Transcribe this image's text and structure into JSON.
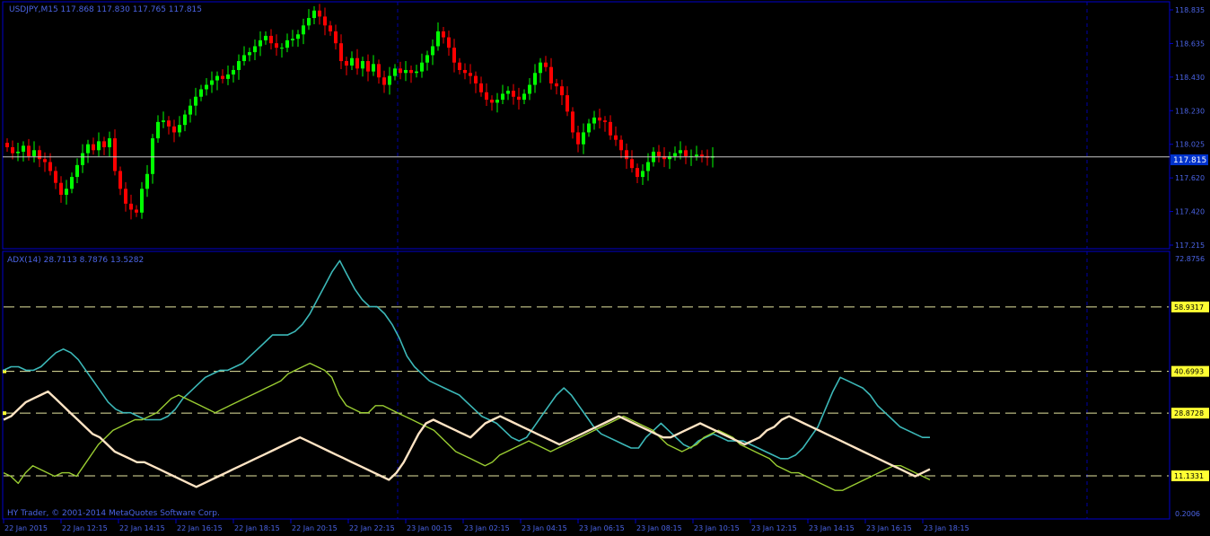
{
  "chart_header": "USDJPY,M15  117.868 117.830 117.765 117.815",
  "indicator_header": "ADX(14) 28.7113 8.7876 13.5282",
  "copyright": "HY Trader, © 2001-2014 MetaQuotes Software Corp.",
  "current_price_label": "117.815",
  "price_axis_labels": [
    "118.835",
    "118.635",
    "118.430",
    "118.230",
    "118.025",
    "117.620",
    "117.420",
    "117.215"
  ],
  "indicator_axis_labels": [
    "72.8756",
    "0.2006"
  ],
  "level_labels": [
    "58.9317",
    "40.6993",
    "28.8728",
    "11.1331"
  ],
  "time_labels": [
    "22 Jan 2015",
    "22 Jan 12:15",
    "22 Jan 14:15",
    "22 Jan 16:15",
    "22 Jan 18:15",
    "22 Jan 20:15",
    "22 Jan 22:15",
    "23 Jan 00:15",
    "23 Jan 02:15",
    "23 Jan 04:15",
    "23 Jan 06:15",
    "23 Jan 08:15",
    "23 Jan 10:15",
    "23 Jan 12:15",
    "23 Jan 14:15",
    "23 Jan 16:15",
    "23 Jan 18:15"
  ],
  "colors": {
    "background": "#000000",
    "frame": "#0000cc",
    "bull_candle": "#00ff00",
    "bear_candle": "#ff0000",
    "adx_line": "#3cb8b8",
    "plus_di_line": "#9acd32",
    "minus_di_line": "#ffe4c4",
    "level_line": "#e6e6a0",
    "price_line": "#c8c8c8"
  },
  "chart_data": [
    {
      "type": "candlestick",
      "title": "USDJPY,M15",
      "ylim": [
        117.215,
        118.835
      ],
      "current_price": 117.815,
      "close_series": [
        117.88,
        117.84,
        117.85,
        117.89,
        117.82,
        117.86,
        117.8,
        117.78,
        117.72,
        117.64,
        117.56,
        117.6,
        117.68,
        117.76,
        117.84,
        117.9,
        117.86,
        117.92,
        117.88,
        117.94,
        117.72,
        117.6,
        117.5,
        117.46,
        117.44,
        117.6,
        117.7,
        117.94,
        118.05,
        118.06,
        118.02,
        117.98,
        118.03,
        118.1,
        118.16,
        118.22,
        118.27,
        118.3,
        118.33,
        118.36,
        118.34,
        118.37,
        118.4,
        118.46,
        118.5,
        118.52,
        118.56,
        118.6,
        118.63,
        118.58,
        118.55,
        118.55,
        118.6,
        118.61,
        118.64,
        118.7,
        118.75,
        118.8,
        118.76,
        118.7,
        118.66,
        118.58,
        118.46,
        118.43,
        118.48,
        118.41,
        118.46,
        118.39,
        118.44,
        118.35,
        118.3,
        118.36,
        118.41,
        118.38,
        118.4,
        118.38,
        118.39,
        118.45,
        118.5,
        118.56,
        118.66,
        118.62,
        118.55,
        118.45,
        118.4,
        118.38,
        118.36,
        118.31,
        118.25,
        118.2,
        118.18,
        118.2,
        118.24,
        118.26,
        118.22,
        118.2,
        118.24,
        118.3,
        118.38,
        118.45,
        118.42,
        118.31,
        118.29,
        118.23,
        118.12,
        117.98,
        117.9,
        117.98,
        118.04,
        118.08,
        118.06,
        118.05,
        117.96,
        117.93,
        117.86,
        117.8,
        117.74,
        117.68,
        117.72,
        117.78,
        117.85,
        117.82,
        117.8,
        117.82,
        117.84,
        117.86,
        117.82,
        117.82,
        117.83,
        117.82,
        117.81,
        117.82
      ]
    },
    {
      "type": "line",
      "title": "ADX(14)",
      "ylim": [
        0.2006,
        72.8756
      ],
      "levels": [
        58.9317,
        40.6993,
        28.8728,
        11.1331
      ],
      "series": [
        {
          "name": "ADX(14)",
          "values": [
            41,
            42,
            42,
            41,
            41,
            42,
            44,
            46,
            47,
            46,
            44,
            41,
            38,
            35,
            32,
            30,
            29,
            29,
            28,
            27,
            27,
            27,
            28,
            30,
            33,
            35,
            37,
            39,
            40,
            41,
            41,
            42,
            43,
            45,
            47,
            49,
            51,
            51,
            51,
            52,
            54,
            57,
            61,
            65,
            69,
            72,
            68,
            64,
            61,
            59,
            59,
            57,
            54,
            50,
            45,
            42,
            40,
            38,
            37,
            36,
            35,
            34,
            32,
            30,
            28,
            27,
            26,
            24,
            22,
            21,
            22,
            25,
            28,
            31,
            34,
            36,
            34,
            31,
            28,
            25,
            23,
            22,
            21,
            20,
            19,
            19,
            22,
            24,
            26,
            24,
            22,
            20,
            19,
            21,
            22,
            23,
            22,
            21,
            21,
            21,
            20,
            19,
            18,
            17,
            16,
            16,
            17,
            19,
            22,
            25,
            30,
            35,
            39,
            38,
            37,
            36,
            34,
            31,
            29,
            27,
            25,
            24,
            23,
            22,
            22
          ]
        },
        {
          "name": "+DI",
          "values": [
            12,
            11,
            9,
            12,
            14,
            13,
            12,
            11,
            12,
            12,
            11,
            14,
            17,
            20,
            22,
            24,
            25,
            26,
            27,
            27,
            28,
            29,
            31,
            33,
            34,
            33,
            32,
            31,
            30,
            29,
            30,
            31,
            32,
            33,
            34,
            35,
            36,
            37,
            38,
            40,
            41,
            42,
            43,
            42,
            41,
            39,
            34,
            31,
            30,
            29,
            29,
            31,
            31,
            30,
            29,
            28,
            27,
            26,
            25,
            24,
            22,
            20,
            18,
            17,
            16,
            15,
            14,
            15,
            17,
            18,
            19,
            20,
            21,
            20,
            19,
            18,
            19,
            20,
            21,
            22,
            23,
            24,
            25,
            26,
            27,
            28,
            27,
            26,
            25,
            24,
            22,
            20,
            19,
            18,
            19,
            20,
            22,
            23,
            24,
            23,
            22,
            20,
            19,
            18,
            17,
            16,
            14,
            13,
            12,
            12,
            11,
            10,
            9,
            8,
            7,
            7,
            8,
            9,
            10,
            11,
            12,
            13,
            14,
            14,
            13,
            12,
            11,
            10
          ]
        },
        {
          "name": "-DI",
          "values": [
            27,
            28,
            30,
            32,
            33,
            34,
            35,
            33,
            31,
            29,
            27,
            25,
            23,
            22,
            20,
            18,
            17,
            16,
            15,
            15,
            14,
            13,
            12,
            11,
            10,
            9,
            8,
            9,
            10,
            11,
            12,
            13,
            14,
            15,
            16,
            17,
            18,
            19,
            20,
            21,
            22,
            21,
            20,
            19,
            18,
            17,
            16,
            15,
            14,
            13,
            12,
            11,
            10,
            12,
            15,
            19,
            23,
            26,
            27,
            26,
            25,
            24,
            23,
            22,
            24,
            26,
            27,
            28,
            27,
            26,
            25,
            24,
            23,
            22,
            21,
            20,
            21,
            22,
            23,
            24,
            25,
            26,
            27,
            28,
            27,
            26,
            25,
            24,
            23,
            22,
            22,
            23,
            24,
            25,
            26,
            25,
            24,
            23,
            22,
            21,
            20,
            21,
            22,
            24,
            25,
            27,
            28,
            27,
            26,
            25,
            24,
            23,
            22,
            21,
            20,
            19,
            18,
            17,
            16,
            15,
            14,
            13,
            12,
            11,
            12,
            13
          ]
        }
      ]
    }
  ]
}
